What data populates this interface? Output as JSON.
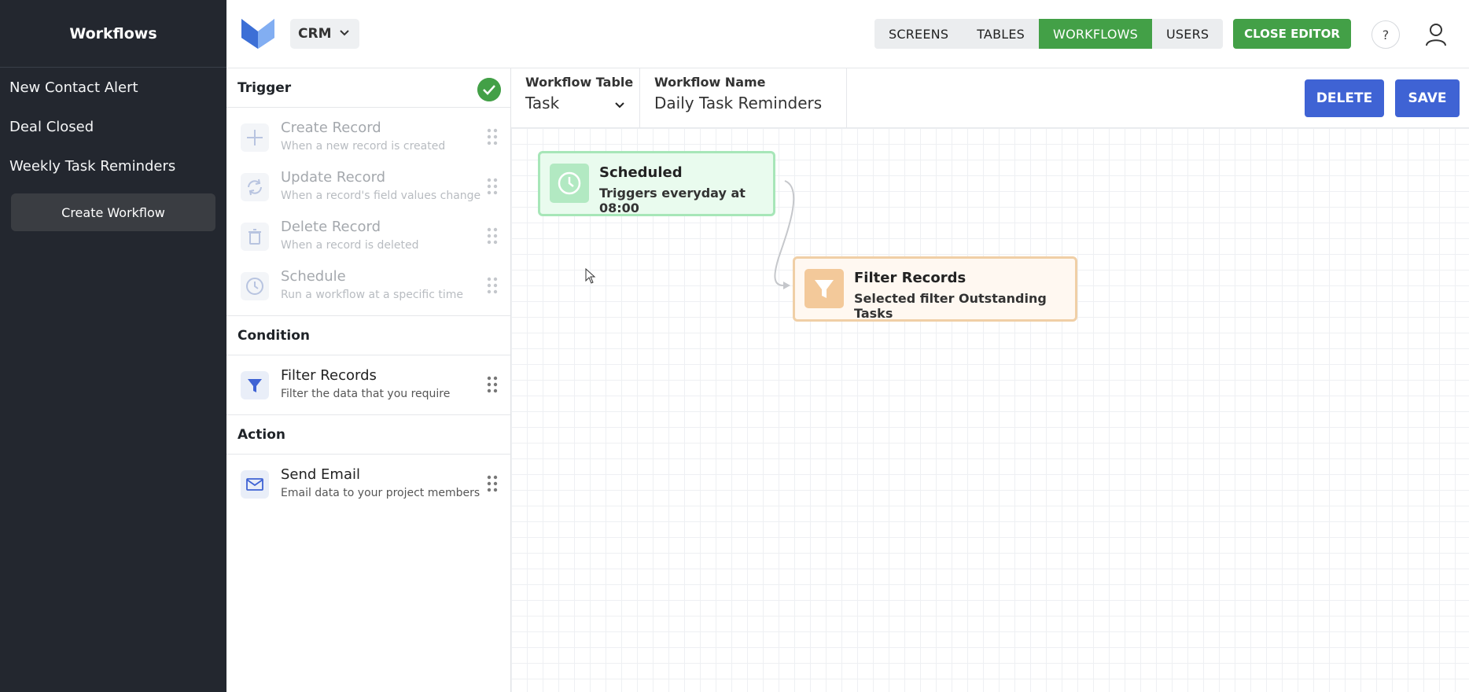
{
  "sidebar": {
    "title": "Workflows",
    "items": [
      {
        "label": "New Contact Alert"
      },
      {
        "label": "Deal Closed"
      },
      {
        "label": "Weekly Task Reminders"
      }
    ],
    "create_label": "Create Workflow"
  },
  "topbar": {
    "app_selector": "CRM",
    "tabs": [
      {
        "label": "SCREENS"
      },
      {
        "label": "TABLES"
      },
      {
        "label": "WORKFLOWS",
        "active": true
      },
      {
        "label": "USERS"
      }
    ],
    "close_editor": "CLOSE EDITOR",
    "help": "?"
  },
  "palette": {
    "trigger": {
      "heading": "Trigger",
      "items": [
        {
          "name": "Create Record",
          "desc": "When a new record is created",
          "icon": "plus-icon"
        },
        {
          "name": "Update Record",
          "desc": "When a record's field values change",
          "icon": "refresh-icon"
        },
        {
          "name": "Delete Record",
          "desc": "When a record is deleted",
          "icon": "trash-icon"
        },
        {
          "name": "Schedule",
          "desc": "Run a workflow at a specific time",
          "icon": "clock-icon"
        }
      ]
    },
    "condition": {
      "heading": "Condition",
      "items": [
        {
          "name": "Filter Records",
          "desc": "Filter the data that you require",
          "icon": "filter-icon"
        }
      ]
    },
    "action": {
      "heading": "Action",
      "items": [
        {
          "name": "Send Email",
          "desc": "Email data to your project members",
          "icon": "mail-icon"
        }
      ]
    }
  },
  "workflow": {
    "table_label": "Workflow Table",
    "table_value": "Task",
    "name_label": "Workflow Name",
    "name_value": "Daily Task Reminders",
    "delete_label": "DELETE",
    "save_label": "SAVE"
  },
  "canvas": {
    "nodes": [
      {
        "title": "Scheduled",
        "subtitle": "Triggers everyday at 08:00",
        "icon": "clock-icon",
        "color": "#43a047"
      },
      {
        "title": "Filter Records",
        "subtitle": "Selected filter Outstanding Tasks",
        "icon": "filter-icon",
        "color": "#e8a25a"
      }
    ]
  },
  "colors": {
    "accent_green": "#43a047",
    "primary_blue": "#3f63d4",
    "sidebar_bg": "#23272f"
  }
}
